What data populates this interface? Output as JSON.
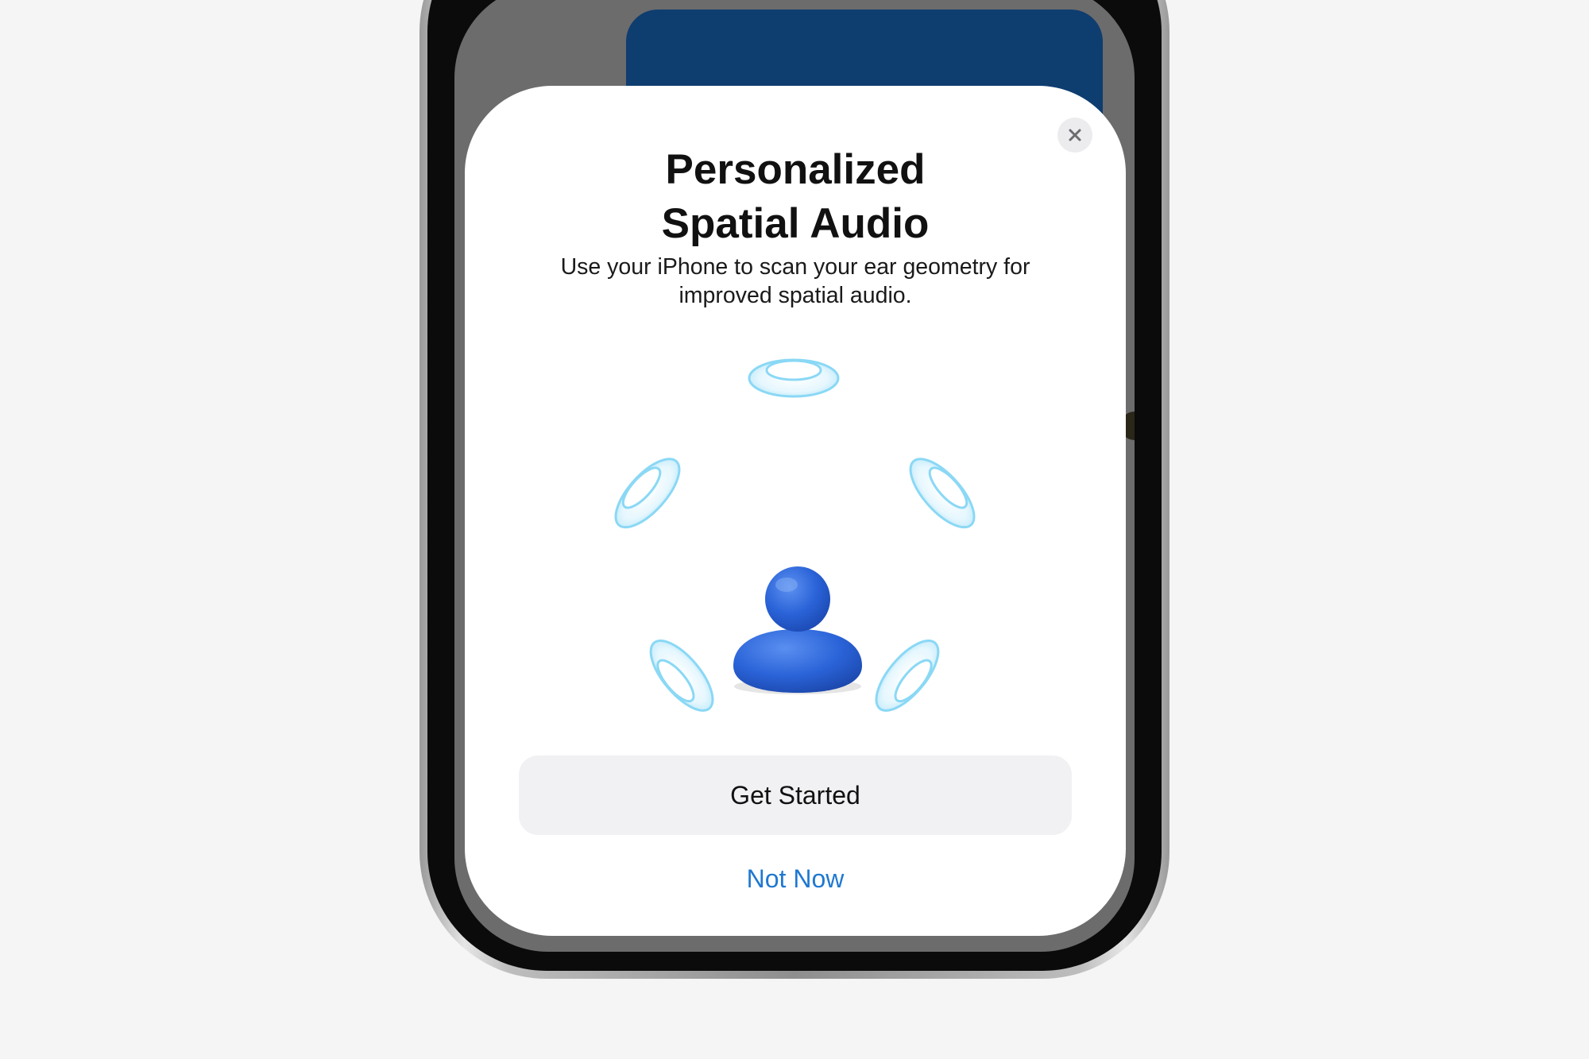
{
  "sheet": {
    "title_line1": "Personalized",
    "title_line2": "Spatial Audio",
    "description_line1": "Use your iPhone to scan your ear geometry for",
    "description_line2": "improved spatial audio.",
    "primary_button_label": "Get Started",
    "secondary_button_label": "Not Now",
    "close_icon": "close-icon"
  },
  "illustration": {
    "center_icon": "person-icon",
    "surround_icon": "speaker-ring-icon",
    "colors": {
      "person": "#2a63d8",
      "rings": "#89d6f4"
    }
  },
  "colors": {
    "page_background": "#f5f5f5",
    "sheet_background": "#ffffff",
    "primary_button_background": "#f1f1f4",
    "link": "#1f78d1",
    "background_card": "#0e3d70"
  }
}
